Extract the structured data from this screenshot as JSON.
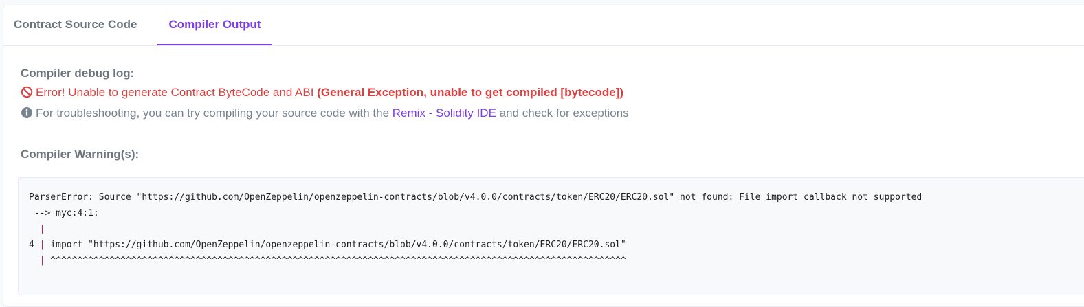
{
  "tabs": [
    {
      "label": "Contract Source Code",
      "active": false
    },
    {
      "label": "Compiler Output",
      "active": true
    }
  ],
  "debug": {
    "heading": "Compiler debug log:",
    "error_text": "Error! Unable to generate Contract ByteCode and ABI",
    "error_bold": "(General Exception, unable to get compiled [bytecode])",
    "info_prefix": "For troubleshooting, you can try compiling your source code with the",
    "info_link": "Remix - Solidity IDE",
    "info_suffix": "and check for exceptions"
  },
  "warnings": {
    "heading": "Compiler Warning(s):",
    "lines": [
      {
        "prefix": "",
        "pipe": "",
        "text": "ParserError: Source \"https://github.com/OpenZeppelin/openzeppelin-contracts/blob/v4.0.0/contracts/token/ERC20/ERC20.sol\" not found: File import callback not supported"
      },
      {
        "prefix": " --> ",
        "pipe": "",
        "text": "myc:4:1:"
      },
      {
        "prefix": "  ",
        "pipe": "|",
        "text": ""
      },
      {
        "prefix": "4 ",
        "pipe": "|",
        "text": " import \"https://github.com/OpenZeppelin/openzeppelin-contracts/blob/v4.0.0/contracts/token/ERC20/ERC20.sol\""
      },
      {
        "prefix": "  ",
        "pipe": "|",
        "text": " ^^^^^^^^^^^^^^^^^^^^^^^^^^^^^^^^^^^^^^^^^^^^^^^^^^^^^^^^^^^^^^^^^^^^^^^^^^^^^^^^^^^^^^^^^^^^^^^^^^^^^^^^^^^"
      }
    ]
  },
  "colors": {
    "accent": "#7b3fe4",
    "error": "#de3e3e",
    "muted": "#77838f",
    "pipe": "#c1275a"
  },
  "icons": {
    "error": "ban-icon",
    "info": "info-circle-icon"
  }
}
